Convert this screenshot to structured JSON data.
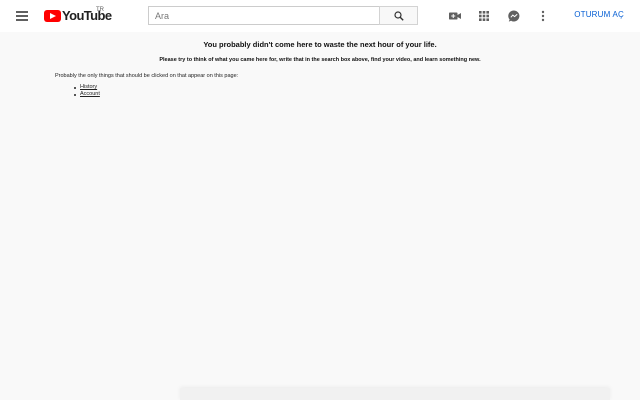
{
  "header": {
    "menu_icon": "hamburger-menu-icon",
    "logo_text": "YouTube",
    "logo_country": "TR",
    "search": {
      "placeholder": "Ara",
      "value": ""
    },
    "search_button_icon": "search-icon",
    "icons": [
      "video-camera-icon",
      "apps-grid-icon",
      "messages-icon",
      "more-vertical-icon"
    ],
    "signin_label": "OTURUM AÇ",
    "colors": {
      "brand_red": "#ff0000",
      "link_blue": "#065fd4"
    }
  },
  "content": {
    "headline": "You probably didn't come here to waste the next hour of your life.",
    "subline": "Please try to think of what you came here for, write that in the search box above, find your video, and learn something new.",
    "intro": "Probably the only things that should be clicked on that appear on this page:",
    "links": [
      "History",
      "Account"
    ]
  }
}
